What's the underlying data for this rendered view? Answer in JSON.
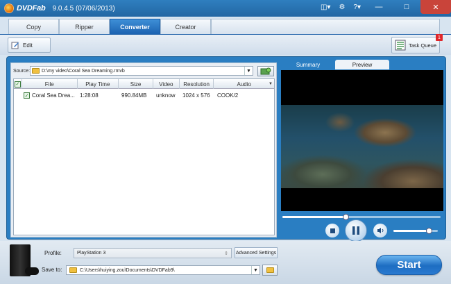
{
  "app": {
    "name": "DVDFab",
    "version": "9.0.4.5 (07/06/2013)"
  },
  "titlebar": {
    "icons": [
      "layout-icon",
      "gear-icon",
      "help-icon"
    ],
    "help_label": "?"
  },
  "tabs": [
    {
      "label": "Copy",
      "active": false
    },
    {
      "label": "Ripper",
      "active": false
    },
    {
      "label": "Converter",
      "active": true
    },
    {
      "label": "Creator",
      "active": false
    }
  ],
  "toolbar": {
    "edit_label": "Edit",
    "task_queue_label": "Task Queue",
    "task_queue_count": "1"
  },
  "source": {
    "label": "Source:",
    "path": "D:\\my video\\Coral Sea Dreaming.rmvb"
  },
  "table": {
    "columns": [
      "File",
      "Play Time",
      "Size",
      "Video",
      "Resolution",
      "Audio"
    ],
    "rows": [
      {
        "file": "Coral Sea Drea...",
        "play_time": "1:28:08",
        "size": "990.84MB",
        "video": "unknow",
        "resolution": "1024 x 576",
        "audio": "COOK/2",
        "checked": true
      }
    ]
  },
  "preview": {
    "tabs": [
      {
        "label": "Summary",
        "active": false
      },
      {
        "label": "Preview",
        "active": true
      }
    ],
    "seek_fraction": 0.4,
    "volume_fraction": 0.8
  },
  "bottom": {
    "profile_label": "Profile:",
    "profile_value": "PlayStation 3",
    "advanced_label": "Advanced Settings",
    "save_label": "Save to:",
    "save_path": "C:\\Users\\huiying.zou\\Documents\\DVDFab9\\",
    "start_label": "Start"
  }
}
